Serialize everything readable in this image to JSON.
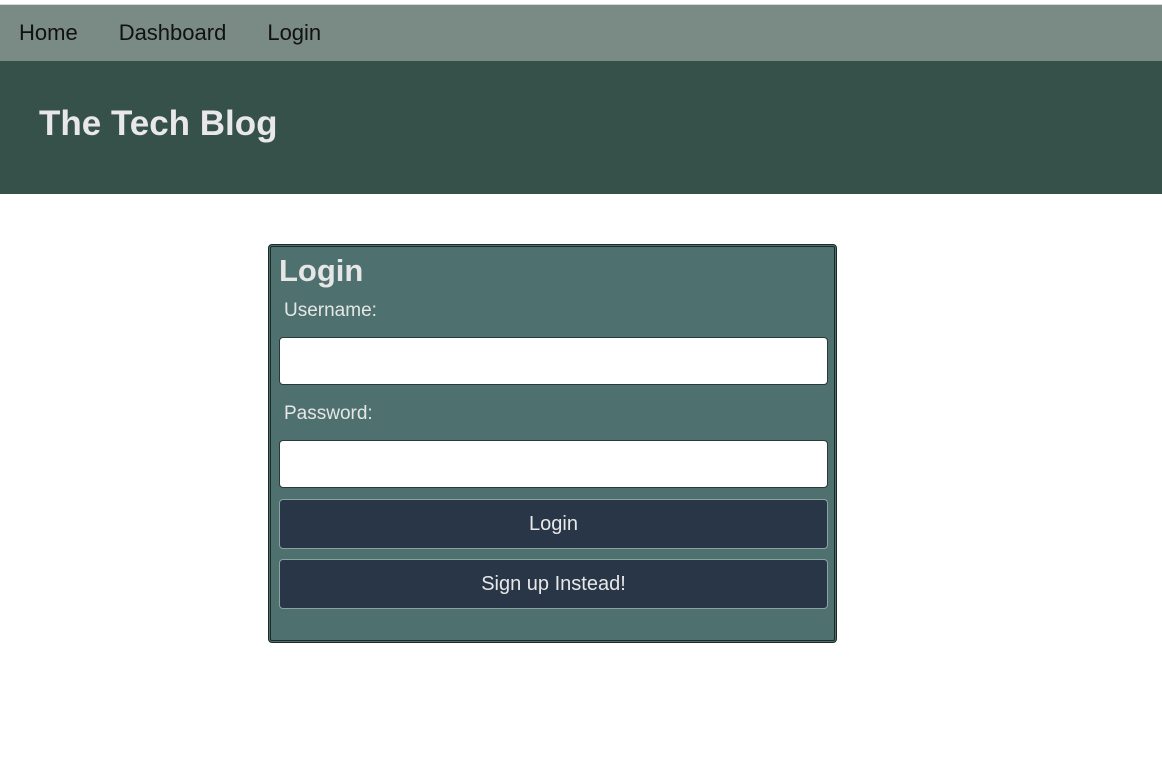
{
  "nav": {
    "items": [
      {
        "label": "Home"
      },
      {
        "label": "Dashboard"
      },
      {
        "label": "Login"
      }
    ]
  },
  "header": {
    "title": "The Tech Blog"
  },
  "login_form": {
    "title": "Login",
    "username_label": "Username:",
    "username_value": "",
    "password_label": "Password:",
    "password_value": "",
    "login_button": "Login",
    "signup_button": "Sign up Instead!"
  },
  "colors": {
    "navbar_bg": "#7a8a85",
    "header_bg": "#36504a",
    "card_bg": "#4e7170",
    "button_bg": "#283647"
  }
}
